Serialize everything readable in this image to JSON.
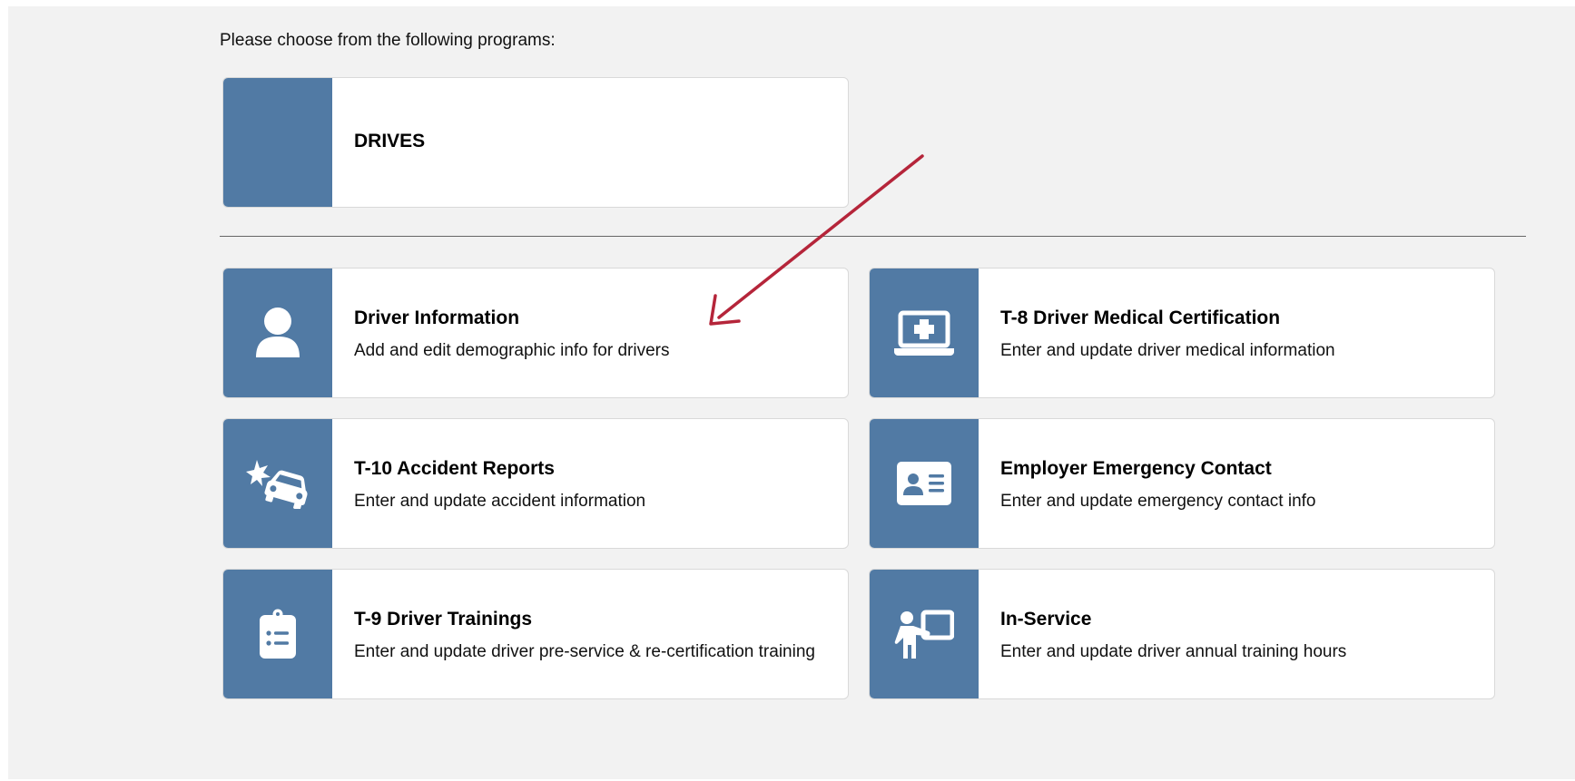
{
  "intro_text": "Please choose from the following programs:",
  "top_card": {
    "title": "DRIVES"
  },
  "programs": [
    {
      "title": "Driver Information",
      "description": "Add and edit demographic info for drivers",
      "icon": "user-icon"
    },
    {
      "title": "T-8 Driver Medical Certification",
      "description": "Enter and update driver medical information",
      "icon": "laptop-medical-icon"
    },
    {
      "title": "T-10 Accident Reports",
      "description": "Enter and update accident information",
      "icon": "car-crash-icon"
    },
    {
      "title": "Employer Emergency Contact",
      "description": "Enter and update emergency contact info",
      "icon": "id-card-icon"
    },
    {
      "title": "T-9 Driver Trainings",
      "description": "Enter and update driver pre-service & re-certification training",
      "icon": "clipboard-list-icon"
    },
    {
      "title": "In-Service",
      "description": "Enter and update driver annual training hours",
      "icon": "chalkboard-teacher-icon"
    }
  ],
  "colors": {
    "page_background": "#f2f2f2",
    "card_accent": "#517aa4",
    "annotation_arrow": "#b5253a"
  }
}
